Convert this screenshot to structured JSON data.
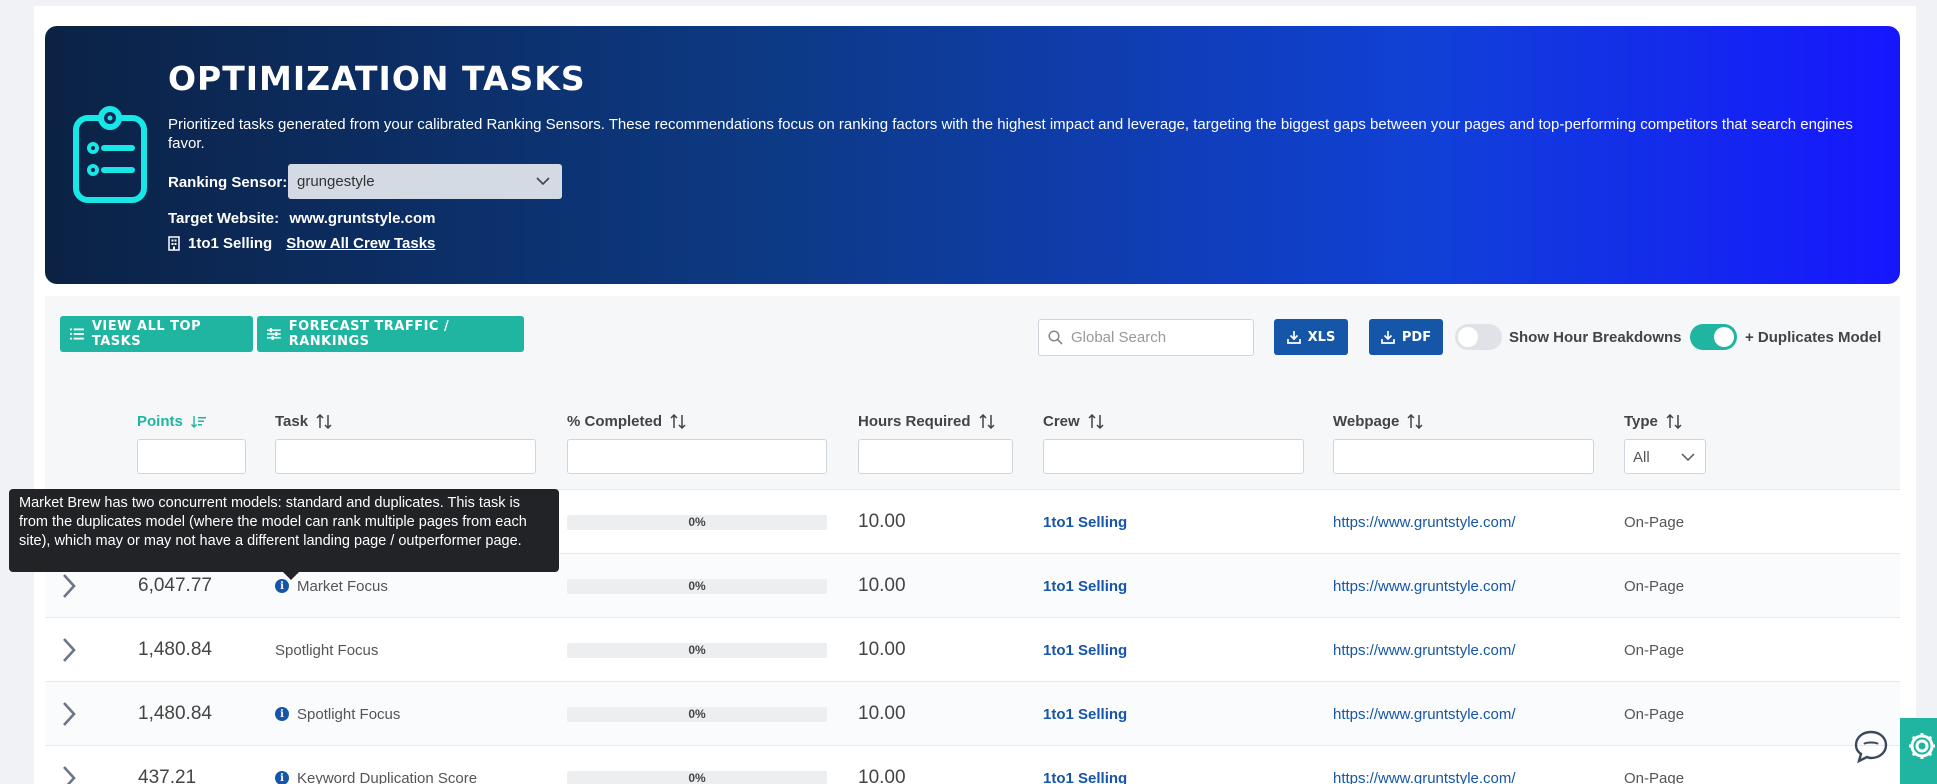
{
  "hero": {
    "title": "OPTIMIZATION TASKS",
    "description": "Prioritized tasks generated from your calibrated Ranking Sensors. These recommendations focus on ranking factors with the highest impact and leverage, targeting the biggest gaps between your pages and top-performing competitors that search engines favor.",
    "sensor_label": "Ranking Sensor:",
    "sensor_value": "grungestyle",
    "target_label": "Target Website:",
    "target_value": "www.gruntstyle.com",
    "crew_name": "1to1 Selling",
    "crew_link": "Show All Crew Tasks",
    "icon": "clipboard-list-icon"
  },
  "toolbar": {
    "view_all_label": "VIEW ALL TOP TASKS",
    "forecast_label": "FORECAST TRAFFIC / RANKINGS",
    "search_placeholder": "Global Search",
    "xls_label": "XLS",
    "pdf_label": "PDF",
    "hour_breakdowns_label": "Show Hour Breakdowns",
    "hour_breakdowns_on": false,
    "duplicates_label": "+ Duplicates Model",
    "duplicates_on": true
  },
  "columns": {
    "points": "Points",
    "task": "Task",
    "completed": "% Completed",
    "hours": "Hours Required",
    "crew": "Crew",
    "webpage": "Webpage",
    "type": "Type",
    "type_filter": "All"
  },
  "rows": [
    {
      "points": "",
      "task": "",
      "info": false,
      "completed": 0,
      "completed_label": "0%",
      "hours": "10.00",
      "crew": "1to1 Selling",
      "webpage": "https://www.gruntstyle.com/",
      "type": "On-Page"
    },
    {
      "points": "6,047.77",
      "task": "Market Focus",
      "info": true,
      "completed": 0,
      "completed_label": "0%",
      "hours": "10.00",
      "crew": "1to1 Selling",
      "webpage": "https://www.gruntstyle.com/",
      "type": "On-Page"
    },
    {
      "points": "1,480.84",
      "task": "Spotlight Focus",
      "info": false,
      "completed": 0,
      "completed_label": "0%",
      "hours": "10.00",
      "crew": "1to1 Selling",
      "webpage": "https://www.gruntstyle.com/",
      "type": "On-Page"
    },
    {
      "points": "1,480.84",
      "task": "Spotlight Focus",
      "info": true,
      "completed": 0,
      "completed_label": "0%",
      "hours": "10.00",
      "crew": "1to1 Selling",
      "webpage": "https://www.gruntstyle.com/",
      "type": "On-Page"
    },
    {
      "points": "437.21",
      "task": "Keyword Duplication Score",
      "info": true,
      "completed": 0,
      "completed_label": "0%",
      "hours": "10.00",
      "crew": "1to1 Selling",
      "webpage": "https://www.gruntstyle.com/",
      "type": "On-Page"
    }
  ],
  "tooltip": {
    "text": "Market Brew has two concurrent models: standard and duplicates. This task is from the duplicates model (where the model can rank multiple pages from each site), which may or may not have a different landing page / outperformer page."
  },
  "colors": {
    "accent": "#1fb5a0",
    "primary": "#1656a8",
    "hero_start": "#0b2244",
    "hero_end": "#1616ff"
  }
}
